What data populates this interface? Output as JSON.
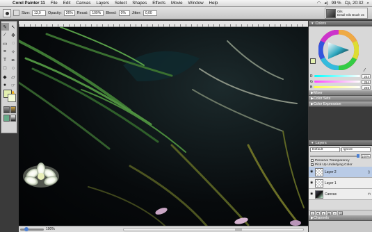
{
  "menubar": {
    "app": "Corel Painter 11",
    "items": [
      "File",
      "Edit",
      "Canvas",
      "Layers",
      "Select",
      "Shapes",
      "Effects",
      "Movie",
      "Window",
      "Help"
    ],
    "battery": "99 %",
    "clock": "Ср, 20:32"
  },
  "propbar": {
    "size_label": "Size:",
    "size_value": "13,0",
    "opacity_label": "Opacity:",
    "opacity_value": "26%",
    "resat_label": "Resat:",
    "resat_value": "100%",
    "bleed_label": "Bleed:",
    "bleed_value": "0%",
    "jitter_label": "Jitter:",
    "jitter_value": "0,00",
    "brush_category": "Oils",
    "brush_variant": "Detail Oils Brush 15"
  },
  "colors": {
    "title": "Colors",
    "r_label": "R",
    "r_value": "244",
    "g_label": "G",
    "g_value": "254",
    "b_label": "B",
    "b_value": "255",
    "main_color": "#e3f0b0",
    "additional_color": "#f4fbd8"
  },
  "collapsed_panels": [
    "Mixer",
    "Color Sets",
    "Color Expression"
  ],
  "layers": {
    "title": "Layers",
    "composite_method": "Default",
    "composite_depth": "Ignore",
    "opacity_value": "100%",
    "preserve_transparency": "Preserve Transparency",
    "pick_up_underlying": "Pick Up Underlying Color",
    "list": [
      {
        "name": "Layer 2",
        "selected": true,
        "thumb": "trans"
      },
      {
        "name": "Layer 1",
        "selected": false,
        "thumb": "trans"
      },
      {
        "name": "Canvas",
        "selected": false,
        "thumb": "canvas"
      }
    ]
  },
  "channels": {
    "title": "Channels"
  },
  "status": {
    "zoom": "100%"
  },
  "toolbox": {
    "tools": [
      "brush-icon",
      "selection-arrow-icon",
      "dropper-icon",
      "layer-adjuster-icon",
      "rectangle-select-icon",
      "lasso-icon",
      "crop-icon",
      "magic-wand-icon",
      "text-icon",
      "pen-icon",
      "shape-icon",
      "transform-icon",
      "paint-bucket-icon",
      "eraser-icon",
      "blend-icon",
      "smudge-icon",
      "magnifier-icon",
      "grabber-icon"
    ]
  }
}
